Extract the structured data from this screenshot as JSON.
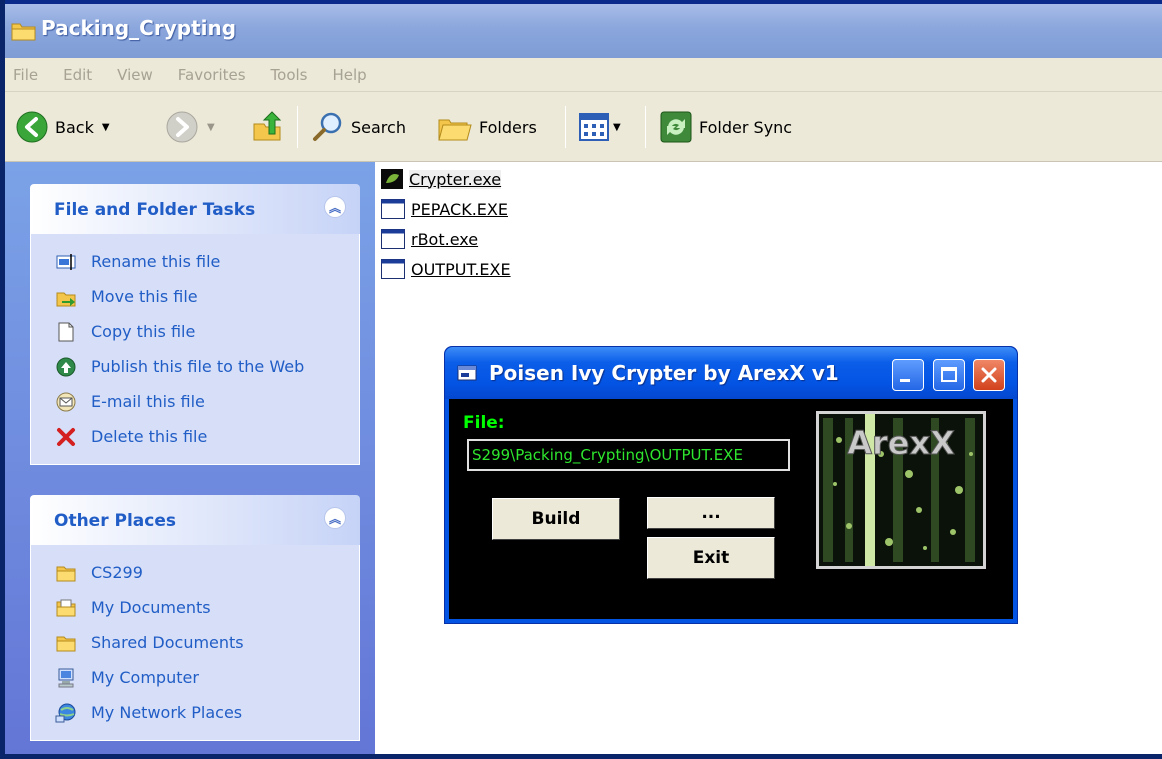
{
  "window": {
    "title": "Packing_Crypting"
  },
  "menu": [
    "File",
    "Edit",
    "View",
    "Favorites",
    "Tools",
    "Help"
  ],
  "toolbar": {
    "back_label": "Back",
    "search_label": "Search",
    "folders_label": "Folders",
    "folder_sync_label": "Folder Sync"
  },
  "file_tasks": {
    "title": "File and Folder Tasks",
    "items": [
      {
        "label": "Rename this file",
        "icon": "rename-icon"
      },
      {
        "label": "Move this file",
        "icon": "move-icon"
      },
      {
        "label": "Copy this file",
        "icon": "copy-icon"
      },
      {
        "label": "Publish this file to the Web",
        "icon": "publish-web-icon"
      },
      {
        "label": "E-mail this file",
        "icon": "email-icon"
      },
      {
        "label": "Delete this file",
        "icon": "delete-icon"
      }
    ]
  },
  "other_places": {
    "title": "Other Places",
    "items": [
      {
        "label": "CS299",
        "icon": "folder-icon"
      },
      {
        "label": "My Documents",
        "icon": "my-documents-icon"
      },
      {
        "label": "Shared Documents",
        "icon": "folder-icon"
      },
      {
        "label": "My Computer",
        "icon": "my-computer-icon"
      },
      {
        "label": "My Network Places",
        "icon": "network-places-icon"
      }
    ]
  },
  "files": [
    {
      "name": "Crypter.exe",
      "icon": "crypter-app-icon",
      "selected": true
    },
    {
      "name": "PEPACK.EXE",
      "icon": "exe-icon",
      "selected": false
    },
    {
      "name": "rBot.exe",
      "icon": "exe-icon",
      "selected": false
    },
    {
      "name": "OUTPUT.EXE",
      "icon": "exe-icon",
      "selected": false
    }
  ],
  "crypter": {
    "title": "Poisen Ivy Crypter by ArexX v1",
    "file_label": "File:",
    "file_path": "S299\\Packing_Crypting\\OUTPUT.EXE",
    "build_label": "Build",
    "browse_label": "...",
    "exit_label": "Exit",
    "logo_text": "ArexX"
  },
  "colors": {
    "xp_blue": "#0454e4",
    "task_link": "#215dc6",
    "crypter_text": "#00ff00"
  }
}
